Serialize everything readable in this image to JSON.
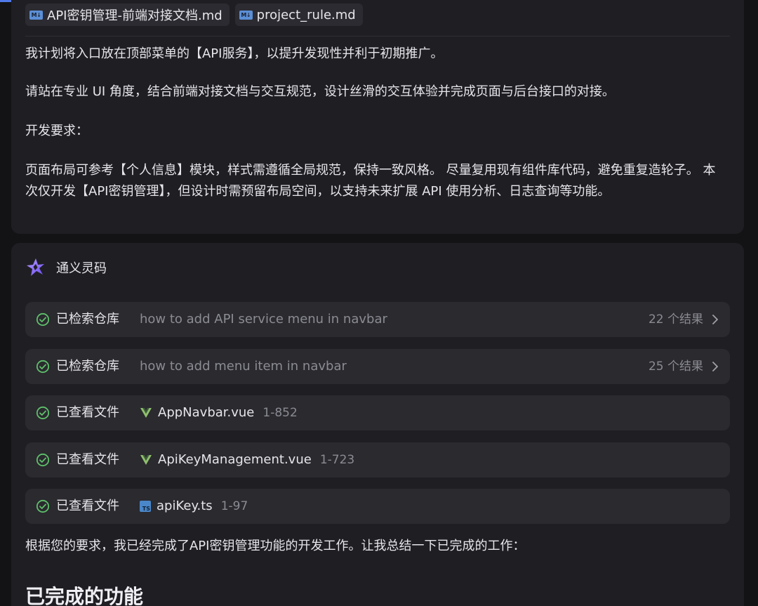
{
  "user_message": {
    "attachments": [
      {
        "icon": "markdown-icon",
        "name": "API密钥管理-前端对接文档.md"
      },
      {
        "icon": "markdown-icon",
        "name": "project_rule.md"
      }
    ],
    "paragraphs": [
      "我计划将入口放在顶部菜单的【API服务】，以提升发现性并利于初期推广。",
      "请站在专业 UI 角度，结合前端对接文档与交互规范，设计丝滑的交互体验并完成页面与后台接口的对接。",
      "开发要求：",
      "页面布局可参考【个人信息】模块，样式需遵循全局规范，保持一致风格。 尽量复用现有组件库代码，避免重复造轮子。 本次仅开发【API密钥管理】，但设计时需预留布局空间，以支持未来扩展 API 使用分析、日志查询等功能。"
    ]
  },
  "assistant": {
    "name": "通义灵码",
    "logo_icon": "tongyi-lingma-logo-icon",
    "steps": [
      {
        "status_icon": "check-circle-icon",
        "label": "已检索仓库",
        "query": "how to add API service menu in navbar",
        "result": "22 个结果"
      },
      {
        "status_icon": "check-circle-icon",
        "label": "已检索仓库",
        "query": "how to add menu item in navbar",
        "result": "25 个结果"
      },
      {
        "status_icon": "check-circle-icon",
        "label": "已查看文件",
        "file_icon": "vue-icon",
        "file": "AppNavbar.vue",
        "range": "1-852"
      },
      {
        "status_icon": "check-circle-icon",
        "label": "已查看文件",
        "file_icon": "vue-icon",
        "file": "ApiKeyManagement.vue",
        "range": "1-723"
      },
      {
        "status_icon": "check-circle-icon",
        "label": "已查看文件",
        "file_icon": "typescript-icon",
        "file": "apiKey.ts",
        "range": "1-97"
      }
    ],
    "summary": "根据您的要求，我已经完成了API密钥管理功能的开发工作。让我总结一下已完成的工作：",
    "heading": "已完成的功能"
  },
  "colors": {
    "background": "#131316",
    "card": "#1f1f23",
    "step_row": "#2a2a2f",
    "check_green": "#5fbf6a",
    "vue_green": "#8fbf6e",
    "ts_blue": "#4a87c9",
    "md_blue": "#5b8fd6",
    "accent": "#4f78e8"
  }
}
